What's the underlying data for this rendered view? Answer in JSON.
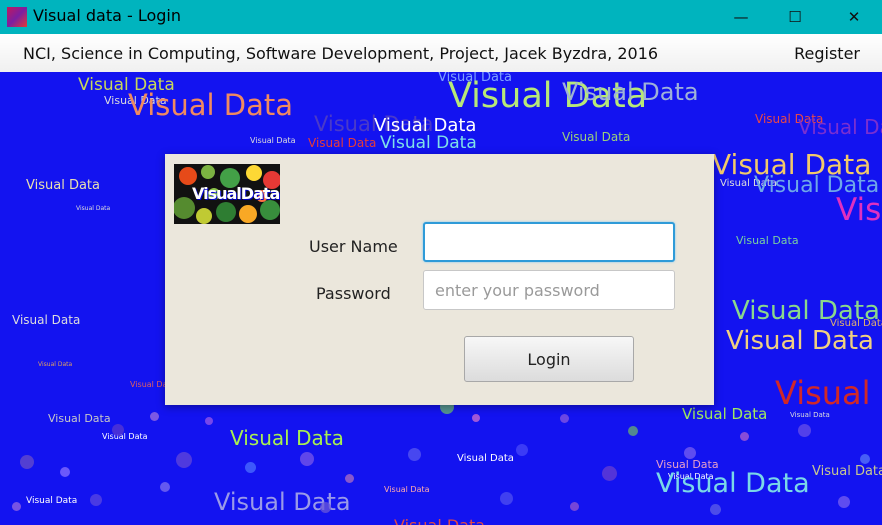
{
  "window": {
    "title": "Visual data - Login",
    "minimize_glyph": "—",
    "maximize_glyph": "☐",
    "close_glyph": "✕"
  },
  "menubar": {
    "info": "NCI, Science in Computing, Software Development, Project, Jacek Byzdra, 2016",
    "register": "Register"
  },
  "background_text": "Visual Data",
  "logo": {
    "text": "VisualData"
  },
  "form": {
    "username_label": "User Name",
    "username_value": "",
    "password_label": "Password",
    "password_placeholder": "enter your password",
    "login_label": "Login"
  },
  "colors": {
    "titlebar": "#00b4be",
    "background": "#1313f0",
    "panel": "#ebe7dc",
    "focus": "#2f9bd8"
  }
}
